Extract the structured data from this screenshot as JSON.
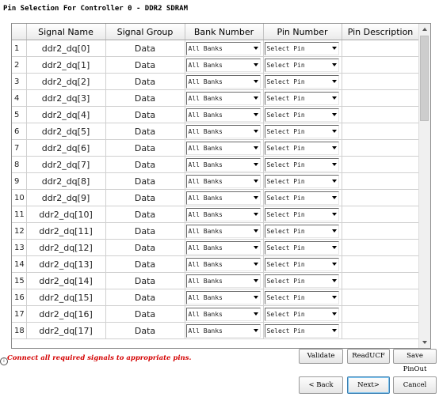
{
  "window": {
    "title": "Pin Selection For Controller 0 - DDR2 SDRAM"
  },
  "table": {
    "columns": [
      "Signal Name",
      "Signal Group",
      "Bank Number",
      "Pin Number",
      "Pin Description"
    ],
    "rows": [
      {
        "num": "1",
        "signal": "ddr2_dq[0]",
        "group": "Data",
        "bank": "All Banks",
        "pin": "Select Pin",
        "desc": ""
      },
      {
        "num": "2",
        "signal": "ddr2_dq[1]",
        "group": "Data",
        "bank": "All Banks",
        "pin": "Select Pin",
        "desc": ""
      },
      {
        "num": "3",
        "signal": "ddr2_dq[2]",
        "group": "Data",
        "bank": "All Banks",
        "pin": "Select Pin",
        "desc": ""
      },
      {
        "num": "4",
        "signal": "ddr2_dq[3]",
        "group": "Data",
        "bank": "All Banks",
        "pin": "Select Pin",
        "desc": ""
      },
      {
        "num": "5",
        "signal": "ddr2_dq[4]",
        "group": "Data",
        "bank": "All Banks",
        "pin": "Select Pin",
        "desc": ""
      },
      {
        "num": "6",
        "signal": "ddr2_dq[5]",
        "group": "Data",
        "bank": "All Banks",
        "pin": "Select Pin",
        "desc": ""
      },
      {
        "num": "7",
        "signal": "ddr2_dq[6]",
        "group": "Data",
        "bank": "All Banks",
        "pin": "Select Pin",
        "desc": ""
      },
      {
        "num": "8",
        "signal": "ddr2_dq[7]",
        "group": "Data",
        "bank": "All Banks",
        "pin": "Select Pin",
        "desc": ""
      },
      {
        "num": "9",
        "signal": "ddr2_dq[8]",
        "group": "Data",
        "bank": "All Banks",
        "pin": "Select Pin",
        "desc": ""
      },
      {
        "num": "10",
        "signal": "ddr2_dq[9]",
        "group": "Data",
        "bank": "All Banks",
        "pin": "Select Pin",
        "desc": ""
      },
      {
        "num": "11",
        "signal": "ddr2_dq[10]",
        "group": "Data",
        "bank": "All Banks",
        "pin": "Select Pin",
        "desc": ""
      },
      {
        "num": "12",
        "signal": "ddr2_dq[11]",
        "group": "Data",
        "bank": "All Banks",
        "pin": "Select Pin",
        "desc": ""
      },
      {
        "num": "13",
        "signal": "ddr2_dq[12]",
        "group": "Data",
        "bank": "All Banks",
        "pin": "Select Pin",
        "desc": ""
      },
      {
        "num": "14",
        "signal": "ddr2_dq[13]",
        "group": "Data",
        "bank": "All Banks",
        "pin": "Select Pin",
        "desc": ""
      },
      {
        "num": "15",
        "signal": "ddr2_dq[14]",
        "group": "Data",
        "bank": "All Banks",
        "pin": "Select Pin",
        "desc": ""
      },
      {
        "num": "16",
        "signal": "ddr2_dq[15]",
        "group": "Data",
        "bank": "All Banks",
        "pin": "Select Pin",
        "desc": ""
      },
      {
        "num": "17",
        "signal": "ddr2_dq[16]",
        "group": "Data",
        "bank": "All Banks",
        "pin": "Select Pin",
        "desc": ""
      },
      {
        "num": "18",
        "signal": "ddr2_dq[17]",
        "group": "Data",
        "bank": "All Banks",
        "pin": "Select Pin",
        "desc": ""
      }
    ]
  },
  "status": {
    "message": "Connect all required signals to appropriate pins.",
    "message_color": "#d40000",
    "icon": "info-icon"
  },
  "buttons": {
    "validate": "Validate",
    "read_ucf": "ReadUCF",
    "save_pinout": "Save PinOut",
    "back": "< Back",
    "next": "Next>",
    "cancel": "Cancel"
  }
}
